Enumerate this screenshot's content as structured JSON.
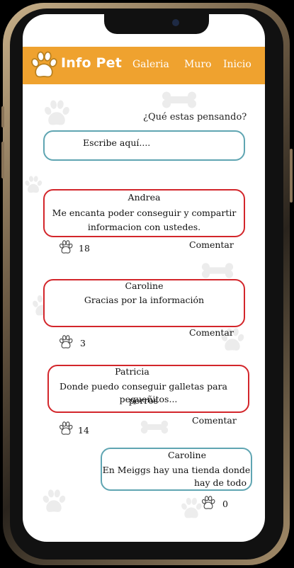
{
  "header": {
    "brand": "Info Pet",
    "nav": [
      "Galeria",
      "Muro",
      "Inicio"
    ],
    "color": "#efa22f"
  },
  "composer": {
    "prompt": "¿Qué estas pensando?",
    "placeholder": "Escribe aquí...."
  },
  "posts": [
    {
      "author": "Andrea",
      "lines": [
        "Me encanta poder conseguir y compartir",
        "informacion con ustedes."
      ],
      "likes": "18",
      "comment_label": "Comentar"
    },
    {
      "author": "Caroline",
      "lines": [
        "Gracias por la información"
      ],
      "likes": "3",
      "comment_label": "Comentar"
    },
    {
      "author": "Patricia",
      "lines": [
        "Donde puedo conseguir galletas para perros",
        "pequeñitos..."
      ],
      "likes": "14",
      "comment_label": "Comentar"
    },
    {
      "author": "Caroline",
      "lines": [
        "En Meiggs hay una tienda donde",
        "hay de todo"
      ],
      "likes": "0"
    }
  ],
  "icons": {
    "like": "paw-icon",
    "logo": "paw-logo-icon"
  },
  "colors": {
    "accent": "#efa22f",
    "teal": "#5fa5b2",
    "red": "#d3262b"
  }
}
